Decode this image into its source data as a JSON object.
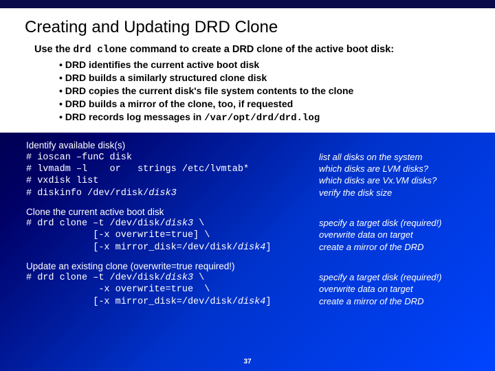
{
  "title": "Creating and Updating DRD Clone",
  "intro_pre": "Use the ",
  "intro_cmd": "drd clone",
  "intro_post": " command to create a DRD clone of the active boot disk:",
  "bullets": [
    "DRD identifies the current active boot disk",
    "DRD builds a similarly structured clone disk",
    "DRD copies the current disk's file system contents to the clone",
    "DRD builds a mirror of the clone, too, if requested"
  ],
  "bullet5_pre": "DRD records log messages in ",
  "bullet5_mono": "/var/opt/drd/drd.log",
  "sec1": {
    "hdr": "Identify available disk(s)",
    "l1_cmd": "# ioscan –funC disk",
    "l1_ann": "list all disks on the system",
    "l2_cmd": "# lvmadm –l    or   strings /etc/lvmtab*",
    "l2_ann": "which disks are LVM disks?",
    "l3_cmd": "# vxdisk list",
    "l3_ann": "which disks are Vx.VM disks?",
    "l4_cmd_a": "# diskinfo /dev/rdisk/",
    "l4_cmd_b": "disk3",
    "l4_ann": "verify the disk size"
  },
  "sec2": {
    "hdr": "Clone the current active boot disk",
    "l1a": "# drd clone –t /dev/disk/",
    "l1b": "disk3",
    "l1c": " \\",
    "l1_ann": "specify a target disk (required!)",
    "l2": "            [-x overwrite=true] \\",
    "l2_ann": "overwrite data on target",
    "l3a": "            [-x mirror_disk=/dev/disk/",
    "l3b": "disk4",
    "l3c": "]",
    "l3_ann": "create a mirror of the DRD"
  },
  "sec3": {
    "hdr": "Update an existing clone (overwrite=true required!)",
    "l1a": "# drd clone –t /dev/disk/",
    "l1b": "disk3",
    "l1c": " \\",
    "l1_ann": "specify a target disk (required!)",
    "l2": "             -x overwrite=true  \\",
    "l2_ann": "overwrite data on target",
    "l3a": "            [-x mirror_disk=/dev/disk/",
    "l3b": "disk4",
    "l3c": "]",
    "l3_ann": "create a mirror of the DRD"
  },
  "pagenum": "37"
}
